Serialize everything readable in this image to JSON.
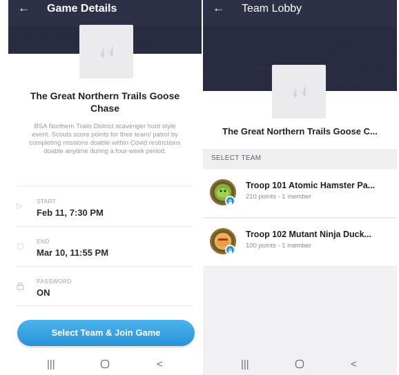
{
  "left": {
    "header_title": "Game Details",
    "game_name": "The Great Northern Trails Goose Chase",
    "description": "BSA Northern Trails District scavenger hunt style event. Scouts score points for their team/ patrol by completing missions doable within Covid restrictions doable anytime during a four-week period.",
    "details": [
      {
        "label": "START",
        "value": "Feb 11, 7:30 PM",
        "icon": "play-outline-icon"
      },
      {
        "label": "END",
        "value": "Mar 10, 11:55 PM",
        "icon": "square-outline-icon"
      },
      {
        "label": "PASSWORD",
        "value": "ON",
        "icon": "lock-icon"
      }
    ],
    "join_button": "Select Team & Join Game"
  },
  "right": {
    "header_title": "Team Lobby",
    "game_name": "The Great Northern Trails Goose C...",
    "section_label": "SELECT TEAM",
    "teams": [
      {
        "name": "Troop 101 Atomic Hamster Pa...",
        "meta": "210 points - 1 member",
        "locked": true
      },
      {
        "name": "Troop 102 Mutant Ninja Duck...",
        "meta": "100 points - 1 member",
        "locked": true
      }
    ]
  },
  "nav": {
    "recents": "|||",
    "home": "○",
    "back": "<"
  },
  "colors": {
    "header": "#2e3048",
    "banner": "#292b40",
    "accent": "#2a8fe2"
  }
}
